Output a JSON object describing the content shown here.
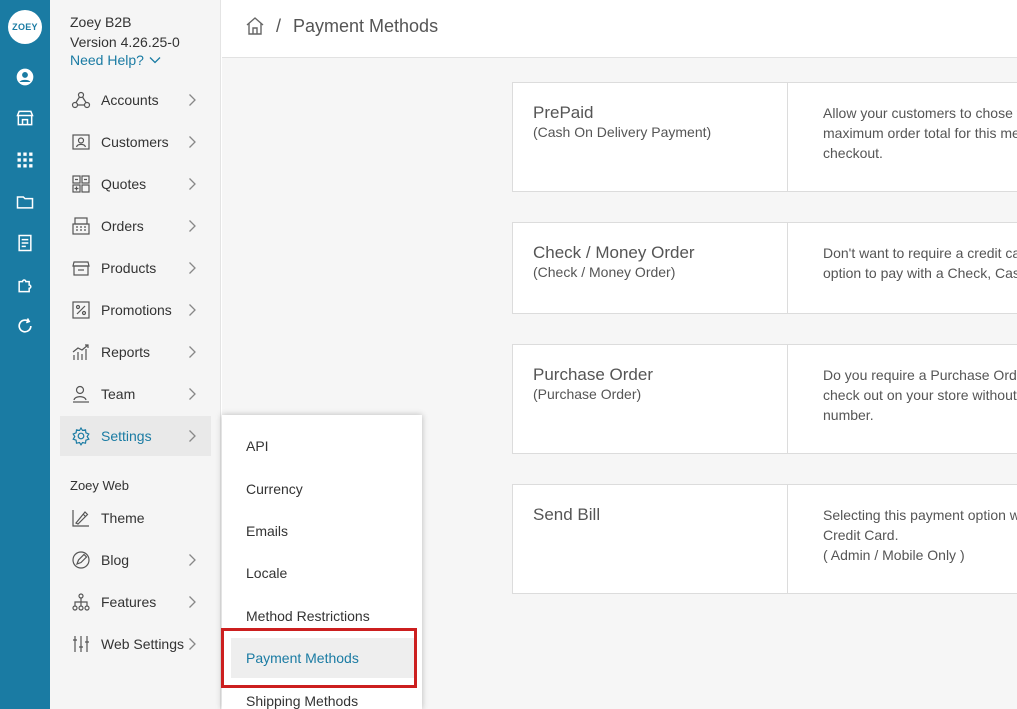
{
  "app": {
    "logo_text": "ZOEY",
    "name": "Zoey B2B",
    "version": "Version 4.26.25-0",
    "help_label": "Need Help?"
  },
  "rail_icons": [
    "account-circle-icon",
    "storefront-icon",
    "grid-icon",
    "folder-icon",
    "document-icon",
    "puzzle-icon",
    "refresh-icon"
  ],
  "sidebar": {
    "items": [
      {
        "label": "Accounts",
        "icon": "accounts-icon"
      },
      {
        "label": "Customers",
        "icon": "customers-icon"
      },
      {
        "label": "Quotes",
        "icon": "quotes-icon"
      },
      {
        "label": "Orders",
        "icon": "orders-icon"
      },
      {
        "label": "Products",
        "icon": "products-icon"
      },
      {
        "label": "Promotions",
        "icon": "percent-icon"
      },
      {
        "label": "Reports",
        "icon": "reports-icon"
      },
      {
        "label": "Team",
        "icon": "team-icon"
      },
      {
        "label": "Settings",
        "icon": "gear-icon"
      }
    ],
    "section_label": "Zoey Web",
    "web_items": [
      {
        "label": "Theme",
        "icon": "theme-icon"
      },
      {
        "label": "Blog",
        "icon": "blog-icon"
      },
      {
        "label": "Features",
        "icon": "features-icon"
      },
      {
        "label": "Web Settings",
        "icon": "sliders-icon"
      }
    ]
  },
  "header": {
    "separator": "/",
    "title": "Payment Methods"
  },
  "payment_methods": [
    {
      "name": "PrePaid",
      "sub": "(Cash On Delivery Payment)",
      "desc": [
        "Allow your customers to chose to",
        "maximum order total for this met",
        "checkout."
      ]
    },
    {
      "name": "Check / Money Order",
      "sub": "(Check / Money Order)",
      "desc": [
        "Don't want to require a credit car",
        "option to pay with a Check, Cash"
      ]
    },
    {
      "name": "Purchase Order",
      "sub": "(Purchase Order)",
      "desc": [
        "Do you require a Purchase Orde",
        "check out on your store without r",
        "number."
      ]
    },
    {
      "name": "Send Bill",
      "sub": "",
      "desc": [
        "Selecting this payment option wi",
        "Credit Card.",
        "( Admin / Mobile Only )"
      ]
    }
  ],
  "submenu": {
    "items": [
      "API",
      "Currency",
      "Emails",
      "Locale",
      "Method Restrictions",
      "Payment Methods",
      "Shipping Methods"
    ],
    "selected": "Payment Methods"
  },
  "colors": {
    "accent": "#1a7ba3",
    "highlight": "#cc1f1f"
  }
}
